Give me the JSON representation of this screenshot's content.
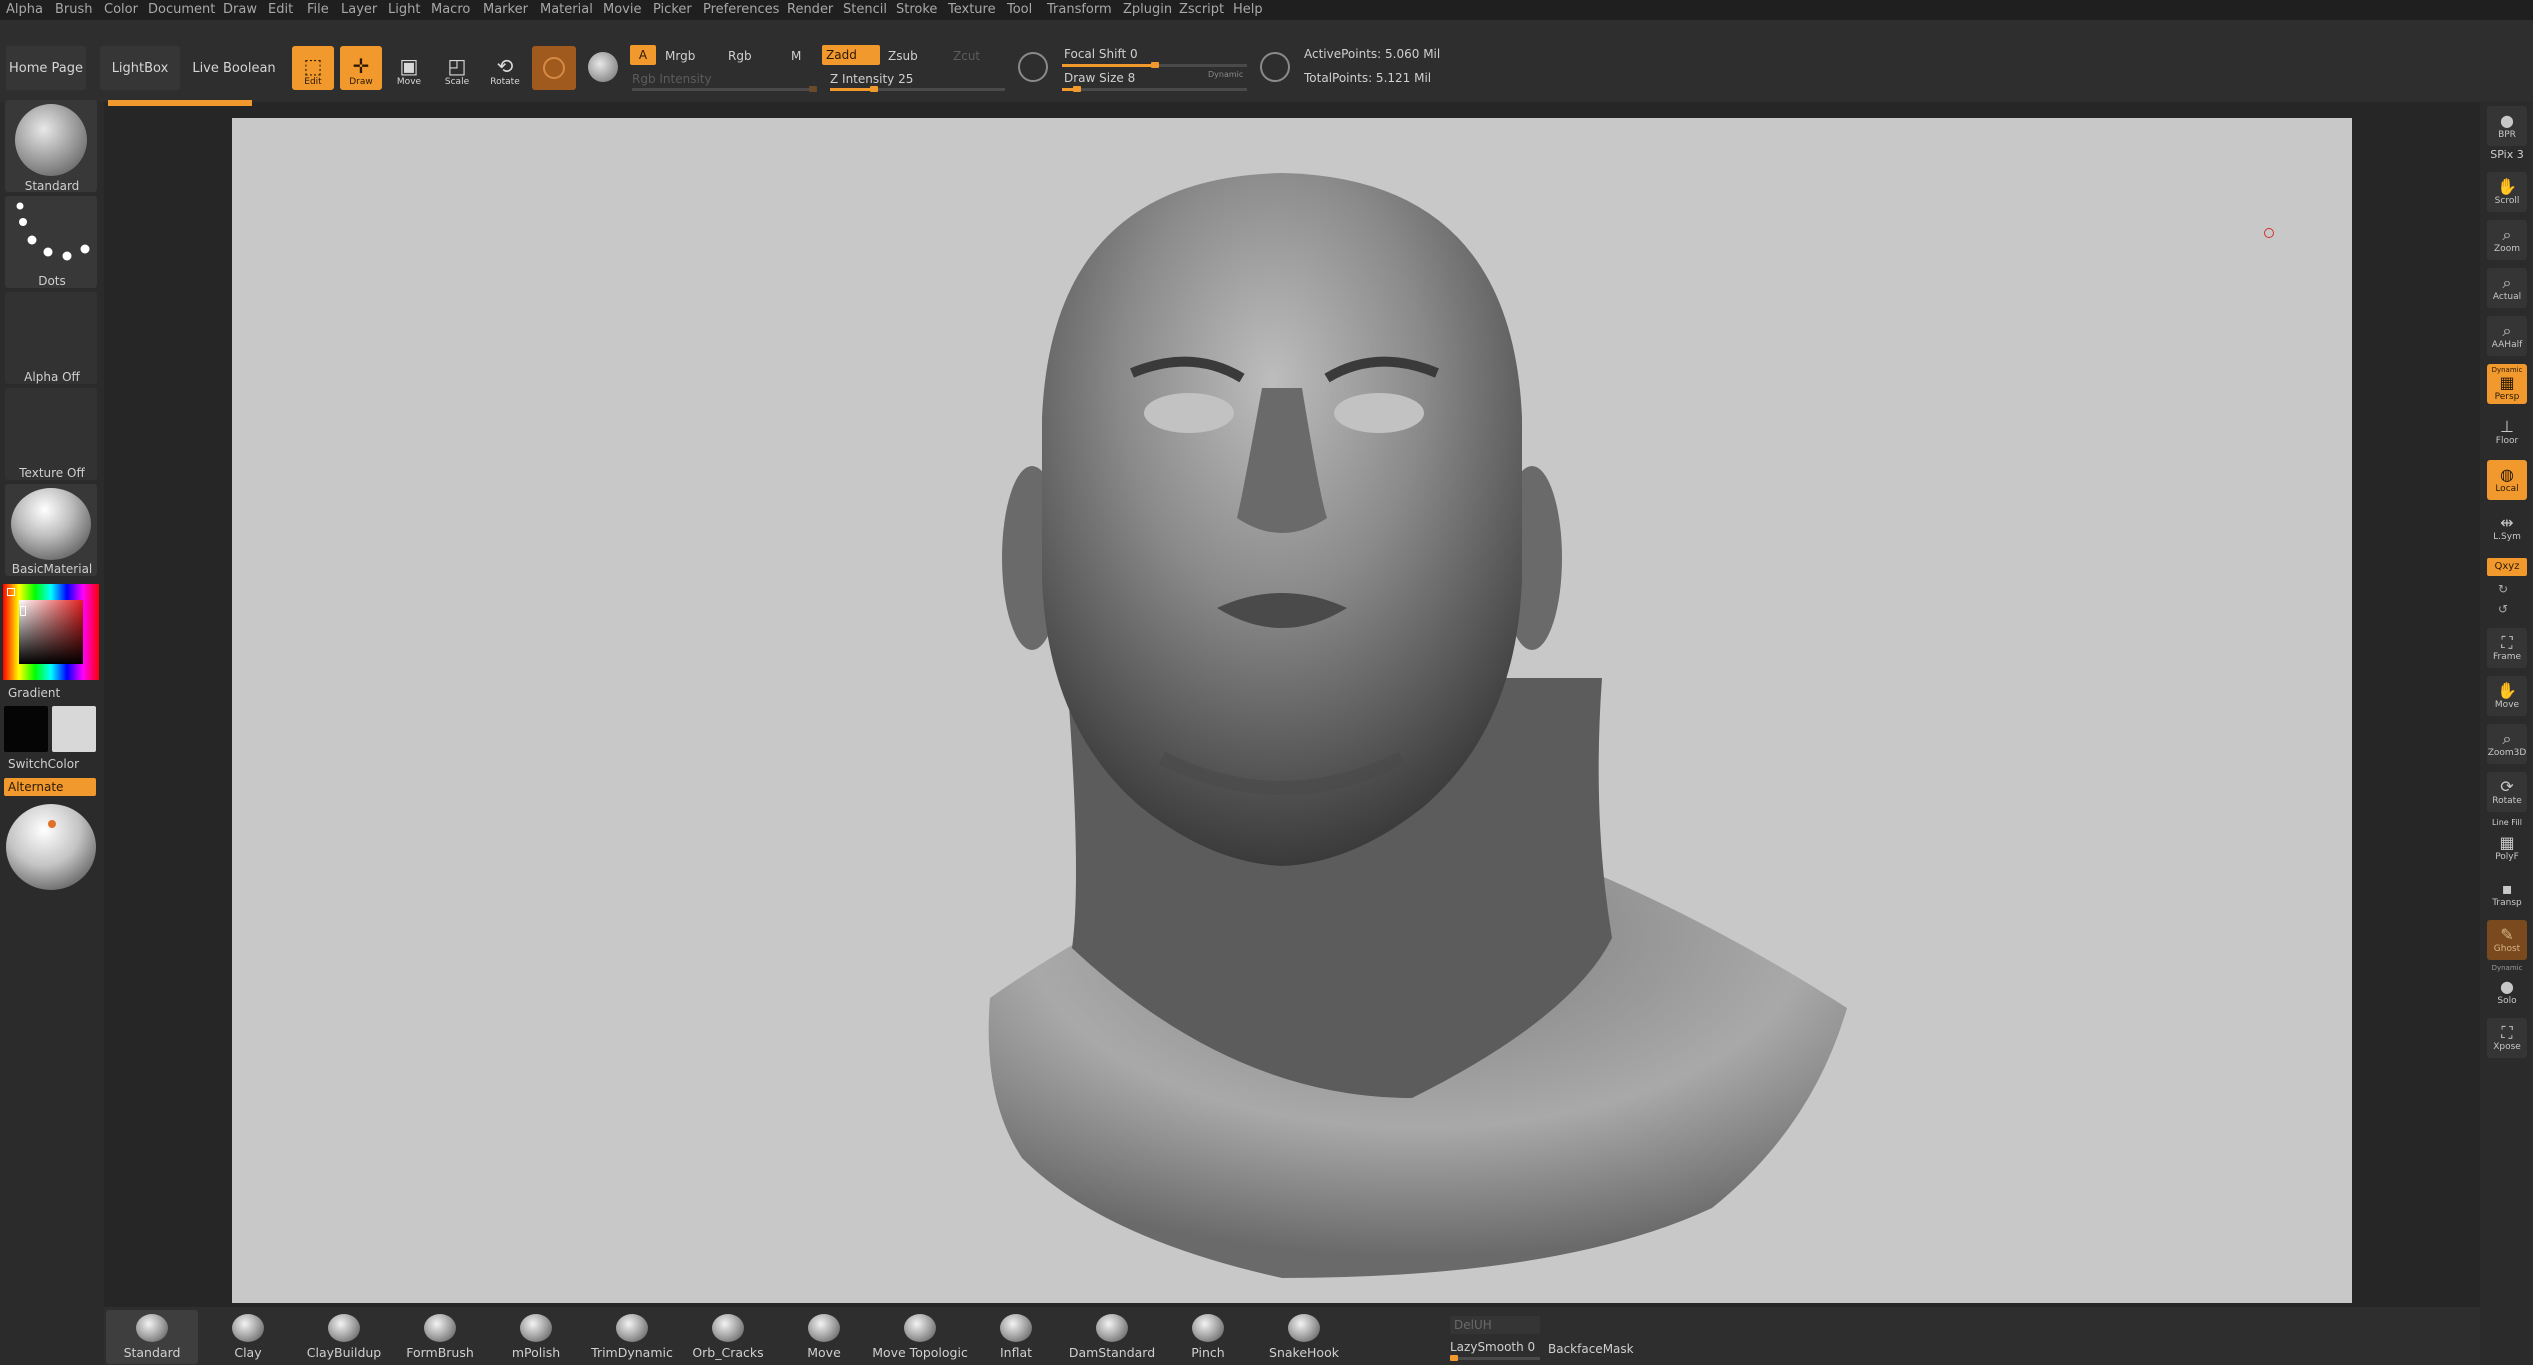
{
  "menu": [
    "Alpha",
    "Brush",
    "Color",
    "Document",
    "Draw",
    "Edit",
    "File",
    "Layer",
    "Light",
    "Macro",
    "Marker",
    "Material",
    "Movie",
    "Picker",
    "Preferences",
    "Render",
    "Stencil",
    "Stroke",
    "Texture",
    "Tool",
    "Transform",
    "Zplugin",
    "Zscript",
    "Help"
  ],
  "nav": {
    "home": "Home Page",
    "lightbox": "LightBox",
    "live_boolean": "Live Boolean"
  },
  "tools": {
    "edit": "Edit",
    "draw": "Draw",
    "move": "Move",
    "scale": "Scale",
    "rotate": "Rotate"
  },
  "channels": {
    "a": "A",
    "mrgb": "Mrgb",
    "rgb": "Rgb",
    "m": "M",
    "rgb_intensity": "Rgb Intensity"
  },
  "zmodes": {
    "zadd": "Zadd",
    "zsub": "Zsub",
    "zcut": "Zcut",
    "z_intensity": "Z Intensity 25"
  },
  "sliders": {
    "z_intensity_value": 0.25,
    "focal_shift_value": 0.5,
    "draw_size_value": 0.08,
    "lazysmooth_value": 0.0
  },
  "focal": {
    "focal_shift": "Focal Shift 0",
    "draw_size": "Draw Size 8",
    "dynamic": "Dynamic"
  },
  "points": {
    "active": "ActivePoints: 5.060 Mil",
    "total": "TotalPoints: 5.121 Mil"
  },
  "left": {
    "brush_label": "Standard",
    "stroke_label": "Dots",
    "alpha_label": "Alpha Off",
    "texture_label": "Texture Off",
    "material_label": "BasicMaterial",
    "gradient_label": "Gradient",
    "switchcolor_label": "SwitchColor",
    "alternate_label": "Alternate"
  },
  "right": [
    {
      "name": "bpr",
      "label": "BPR",
      "state": "normal"
    },
    {
      "name": "spix",
      "label": "SPix 3",
      "state": "text"
    },
    {
      "name": "scroll",
      "label": "Scroll",
      "state": "normal"
    },
    {
      "name": "zoom",
      "label": "Zoom",
      "state": "normal"
    },
    {
      "name": "actual",
      "label": "Actual",
      "state": "normal"
    },
    {
      "name": "aahalf",
      "label": "AAHalf",
      "state": "normal"
    },
    {
      "name": "persp",
      "label": "Persp",
      "state": "on"
    },
    {
      "name": "floor",
      "label": "Floor",
      "state": "normal"
    },
    {
      "name": "local",
      "label": "Local",
      "state": "on"
    },
    {
      "name": "lsym",
      "label": "L.Sym",
      "state": "normal"
    },
    {
      "name": "xyz",
      "label": "Qxyz",
      "state": "on-small"
    },
    {
      "name": "frame",
      "label": "Frame",
      "state": "normal"
    },
    {
      "name": "move",
      "label": "Move",
      "state": "normal"
    },
    {
      "name": "zoom3d",
      "label": "Zoom3D",
      "state": "normal"
    },
    {
      "name": "rotate",
      "label": "Rotate",
      "state": "normal"
    },
    {
      "name": "polyf",
      "label": "PolyF",
      "state": "normal"
    },
    {
      "name": "transp",
      "label": "Transp",
      "state": "normal"
    },
    {
      "name": "ghost",
      "label": "Ghost",
      "state": "brown"
    },
    {
      "name": "solo",
      "label": "Solo",
      "state": "normal"
    },
    {
      "name": "xpose",
      "label": "Xpose",
      "state": "normal"
    }
  ],
  "right_extra": {
    "dynamic": "Dynamic",
    "line_fill": "Line Fill"
  },
  "brushes": [
    "Standard",
    "Clay",
    "ClayBuildup",
    "FormBrush",
    "mPolish",
    "TrimDynamic",
    "Orb_Cracks",
    "Move",
    "Move Topologic",
    "Inflat",
    "DamStandard",
    "Pinch",
    "SnakeHook"
  ],
  "bottom": {
    "deluh": "DelUH",
    "lazysmooth": "LazySmooth 0",
    "backfacemask": "BackfaceMask"
  }
}
